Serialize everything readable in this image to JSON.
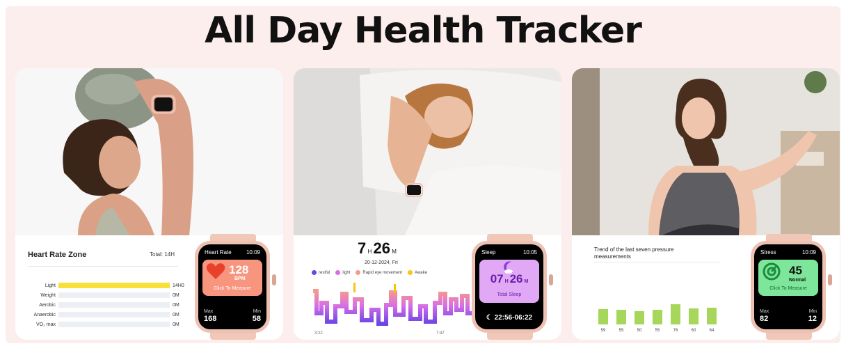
{
  "title": "All Day Health Tracker",
  "heart_card": {
    "panel_title": "Heart Rate Zone",
    "total_label": "Total:",
    "total_value": "14H",
    "zones": [
      {
        "label": "Light",
        "value": "14H0",
        "fraction": 1.0
      },
      {
        "label": "Weight",
        "value": "0M",
        "fraction": 0
      },
      {
        "label": "Aerobic",
        "value": "0M",
        "fraction": 0
      },
      {
        "label": "Anaerobic",
        "value": "0M",
        "fraction": 0
      },
      {
        "label": "VO₂ max",
        "value": "0M",
        "fraction": 0
      }
    ],
    "watch": {
      "app": "Heart Rate",
      "time": "10:09",
      "value": "128",
      "unit": "BPM",
      "action": "Click To Measure",
      "max_label": "Max",
      "max_value": "168",
      "min_label": "Min",
      "min_value": "58",
      "tile_color": "#f7957f"
    }
  },
  "sleep_card": {
    "hours": "7",
    "h_unit": "H",
    "minutes": "26",
    "m_unit": "M",
    "date": "20-12-2024, Fri",
    "legend": [
      {
        "label": "restful",
        "color": "#6a44e6"
      },
      {
        "label": "light",
        "color": "#d86ee6"
      },
      {
        "label": "Rapid eye movement",
        "color": "#f79a8a"
      },
      {
        "label": "Awake",
        "color": "#f5c518"
      }
    ],
    "axis_start": "3:22",
    "axis_end": "7:47",
    "watch": {
      "app": "Sleep",
      "time": "10:05",
      "hours": "07",
      "h_unit": "H",
      "minutes": "26",
      "m_unit": "M",
      "caption": "Total Sleep",
      "range": "22:56-06:22",
      "tile_color": "#e1a8f5"
    }
  },
  "stress_card": {
    "panel_title": "Trend of the last seven pressure measurements",
    "bars": [
      {
        "label": "59",
        "value": 59
      },
      {
        "label": "55",
        "value": 55
      },
      {
        "label": "50",
        "value": 50
      },
      {
        "label": "55",
        "value": 55
      },
      {
        "label": "76",
        "value": 76
      },
      {
        "label": "60",
        "value": 60
      },
      {
        "label": "64",
        "value": 64
      }
    ],
    "watch": {
      "app": "Stress",
      "time": "10:09",
      "value": "45",
      "status": "Normal",
      "action": "Click To Measure",
      "max_label": "Max",
      "max_value": "82",
      "min_label": "Min",
      "min_value": "12",
      "tile_color": "#7de69a"
    }
  }
}
